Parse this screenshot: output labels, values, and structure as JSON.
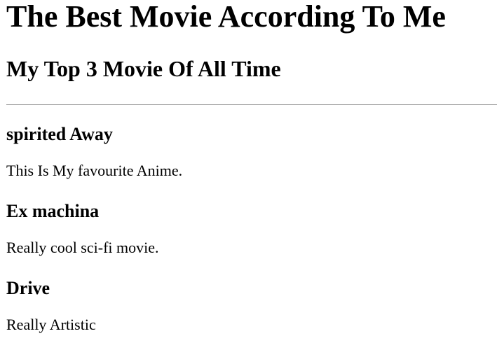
{
  "page": {
    "title": "The Best Movie According To Me",
    "subtitle": "My Top 3 Movie Of All Time"
  },
  "movies": [
    {
      "title": "spirited Away",
      "description": "This Is My favourite Anime."
    },
    {
      "title": "Ex machina",
      "description": "Really cool sci-fi movie."
    },
    {
      "title": "Drive",
      "description": "Really Artistic"
    }
  ]
}
